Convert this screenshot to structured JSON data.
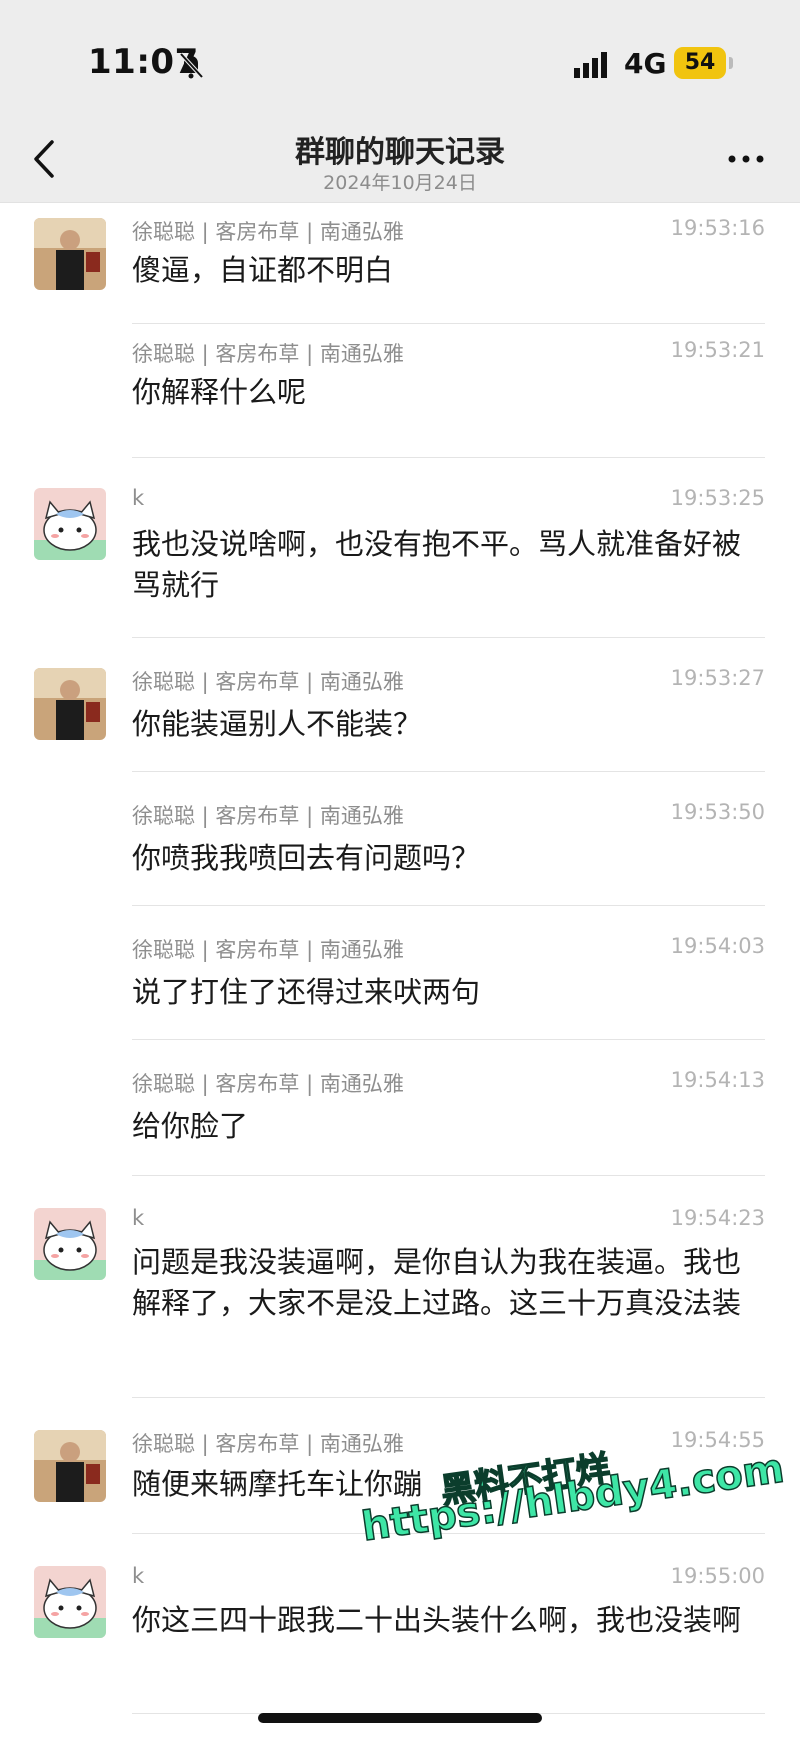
{
  "status_bar": {
    "time": "11:07",
    "network": "4G",
    "battery": "54"
  },
  "nav": {
    "title": "群聊的聊天记录",
    "date": "2024年10月24日"
  },
  "messages": [
    {
      "avatar": "avatar-man",
      "sender": "徐聪聪 | 客房布草 | 南通弘雅",
      "time": "19:53:16",
      "text": "傻逼，自证都不明白"
    },
    {
      "avatar": "",
      "sender": "徐聪聪 | 客房布草 | 南通弘雅",
      "time": "19:53:21",
      "text": "你解释什么呢"
    },
    {
      "avatar": "avatar-cat",
      "sender": "k",
      "time": "19:53:25",
      "text": "我也没说啥啊，也没有抱不平。骂人就准备好被骂就行"
    },
    {
      "avatar": "avatar-man",
      "sender": "徐聪聪 | 客房布草 | 南通弘雅",
      "time": "19:53:27",
      "text": "你能装逼别人不能装？"
    },
    {
      "avatar": "",
      "sender": "徐聪聪 | 客房布草 | 南通弘雅",
      "time": "19:53:50",
      "text": "你喷我我喷回去有问题吗？"
    },
    {
      "avatar": "",
      "sender": "徐聪聪 | 客房布草 | 南通弘雅",
      "time": "19:54:03",
      "text": "说了打住了还得过来吠两句"
    },
    {
      "avatar": "",
      "sender": "徐聪聪 | 客房布草 | 南通弘雅",
      "time": "19:54:13",
      "text": "给你脸了"
    },
    {
      "avatar": "avatar-cat",
      "sender": "k",
      "time": "19:54:23",
      "text": "问题是我没装逼啊，是你自认为我在装逼。我也解释了，大家不是没上过路。这三十万真没法装"
    },
    {
      "avatar": "avatar-man",
      "sender": "徐聪聪 | 客房布草 | 南通弘雅",
      "time": "19:54:55",
      "text": "随便来辆摩托车让你蹦"
    },
    {
      "avatar": "avatar-cat",
      "sender": "k",
      "time": "19:55:00",
      "text": "你这三四十跟我二十出头装什么啊，我也没装啊"
    }
  ],
  "watermark": {
    "line1": "黑料不打烊",
    "line2": "https://hlbdy4.com"
  },
  "icons": {
    "back": "chevron-left-icon",
    "more": "more-dots-icon",
    "mute": "bell-slash-icon",
    "signal": "signal-icon"
  }
}
